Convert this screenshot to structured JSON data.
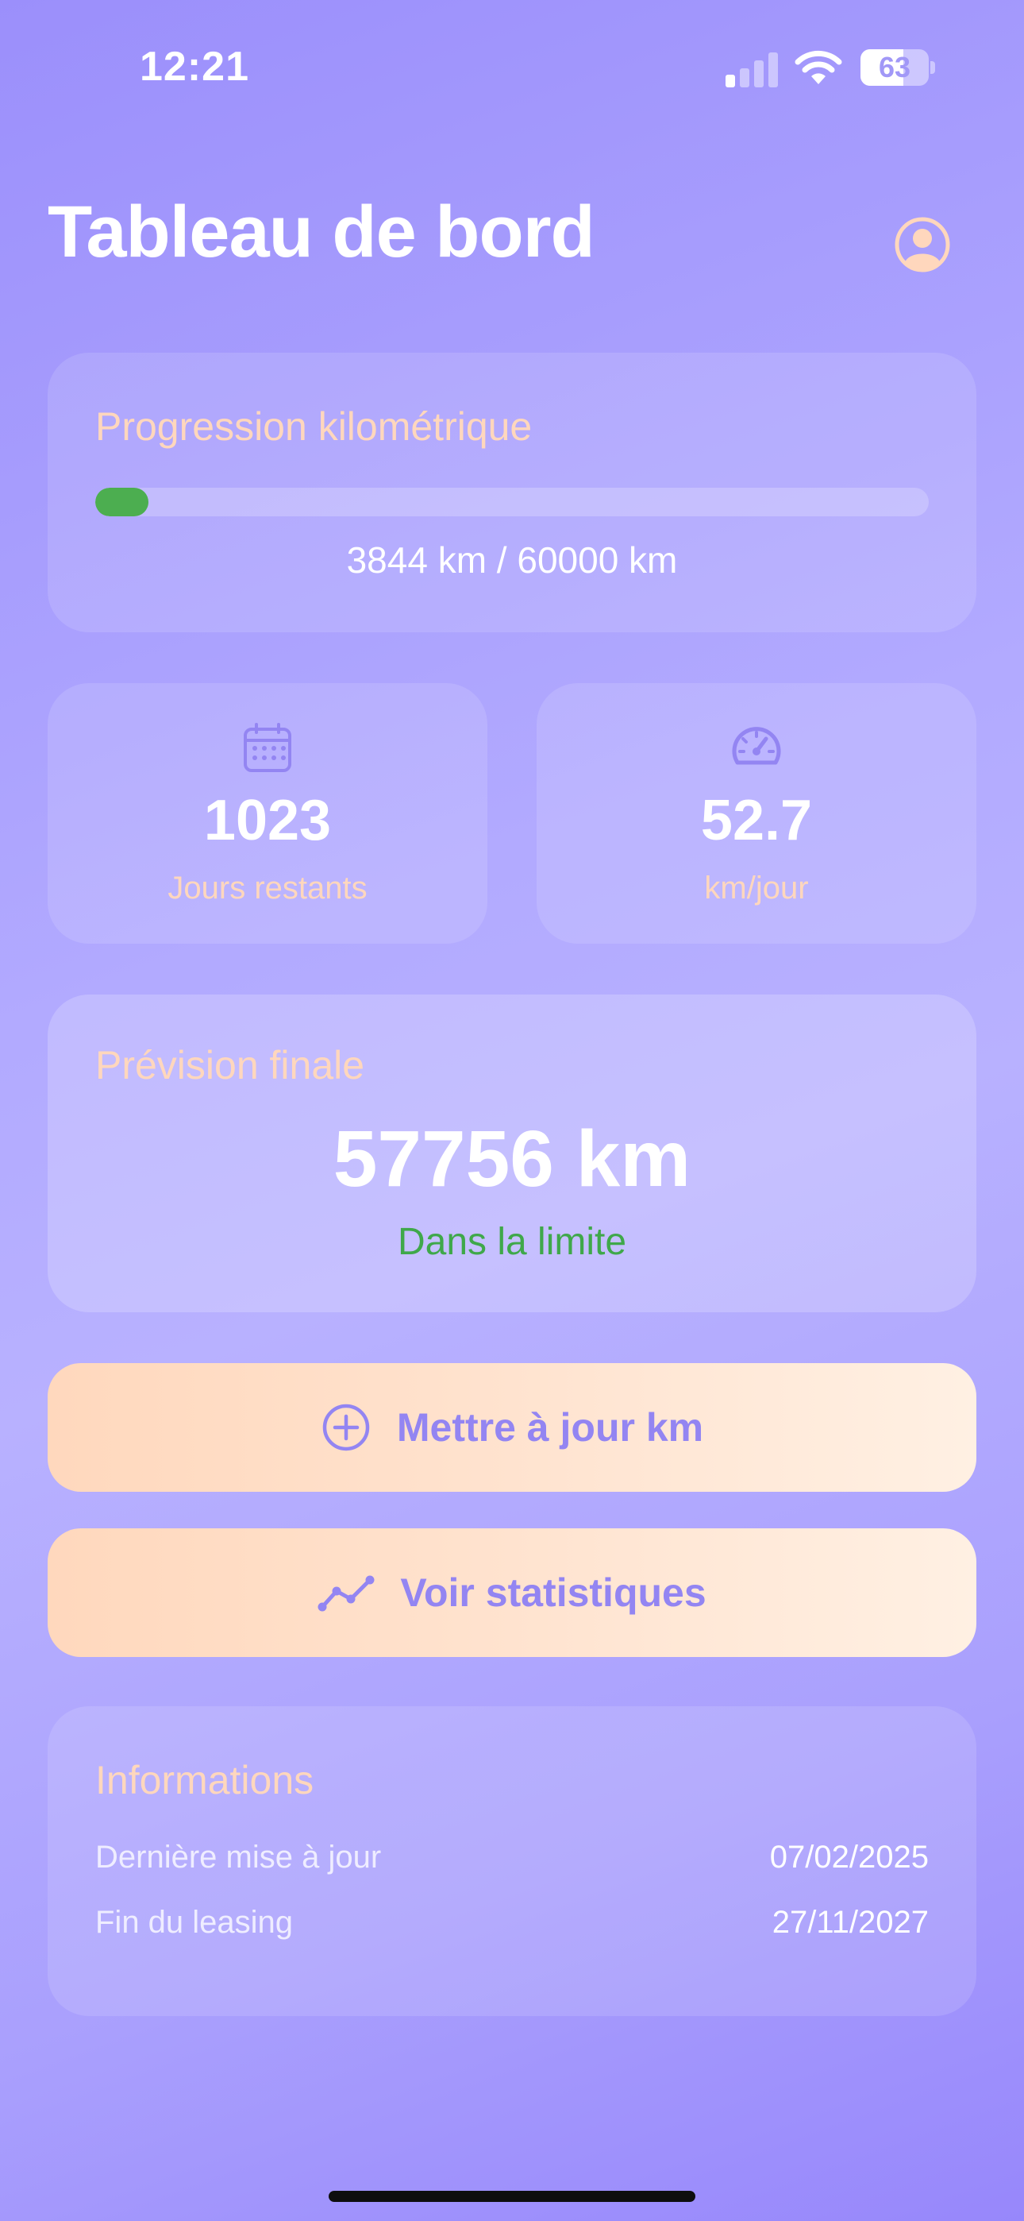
{
  "status_bar": {
    "time": "12:21",
    "battery_percent": 63,
    "signal_bars_active": 1
  },
  "header": {
    "title": "Tableau de bord",
    "profile_icon": "person-circle-icon"
  },
  "progress": {
    "title": "Progression kilométrique",
    "current_km": 3844,
    "limit_km": 60000,
    "text": "3844 km / 60000 km",
    "fill_color": "#4cae50"
  },
  "stats": [
    {
      "icon": "calendar-icon",
      "value": "1023",
      "label": "Jours restants"
    },
    {
      "icon": "speedometer-icon",
      "value": "52.7",
      "label": "km/jour"
    }
  ],
  "forecast": {
    "title": "Prévision finale",
    "value": "57756 km",
    "status": "Dans la limite",
    "status_color": "#3fa84a"
  },
  "actions": {
    "update": {
      "label": "Mettre à jour km",
      "icon": "plus-circle-icon"
    },
    "stats": {
      "label": "Voir statistiques",
      "icon": "line-chart-icon"
    }
  },
  "info": {
    "title": "Informations",
    "rows": [
      {
        "label": "Dernière mise à jour",
        "value": "07/02/2025"
      },
      {
        "label": "Fin du leasing",
        "value": "27/11/2027"
      }
    ]
  },
  "colors": {
    "accent": "#9385f2",
    "peach": "#ffd7bd",
    "background": "#a99ffd"
  }
}
